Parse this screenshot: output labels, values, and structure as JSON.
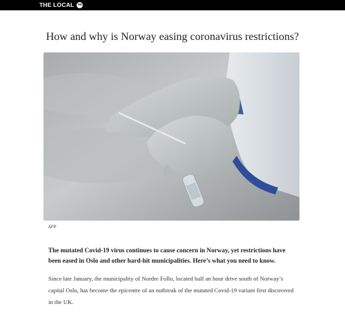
{
  "header": {
    "brand": "THE LOCAL",
    "badge": "no"
  },
  "article": {
    "title": "How and why is Norway easing coronavirus restrictions?",
    "image_alt": "Gloved hands holding a Covid-19 test swab and tube",
    "image_credit": "AFP",
    "lead": "The mutated Covid-19 virus continues to cause concern in Norway, yet restrictions have been eased in Oslo and other hard-hit municipalities. Here’s what you need to know.",
    "paragraph_1": "Since late January, the municipality of Nordre Follo, located half an hour drive south of Norway’s capital Oslo, has become the epicentre of an outbreak of the mutated Covid-19 variant first discovered in the UK."
  }
}
